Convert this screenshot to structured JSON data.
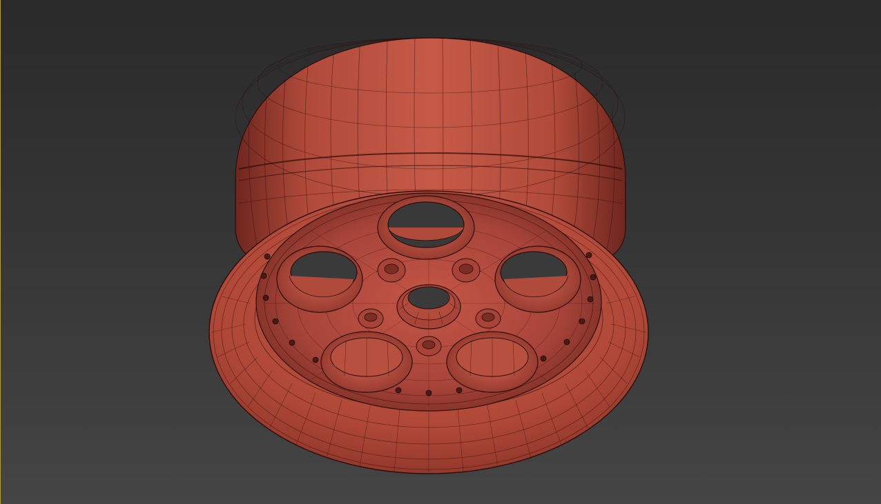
{
  "viewport": {
    "name": "perspective-viewport",
    "active": true,
    "active_border_color": "#b8a030",
    "background_top": "#2a2a2a",
    "background_bottom": "#454545"
  },
  "model": {
    "object": "wheel-rim",
    "display": "shaded-with-wireframe",
    "material_color": "#b04a3a",
    "wire_color": "#2a0c08",
    "spoke_windows": 5,
    "lug_holes": 5,
    "rim_bolts": 18
  }
}
